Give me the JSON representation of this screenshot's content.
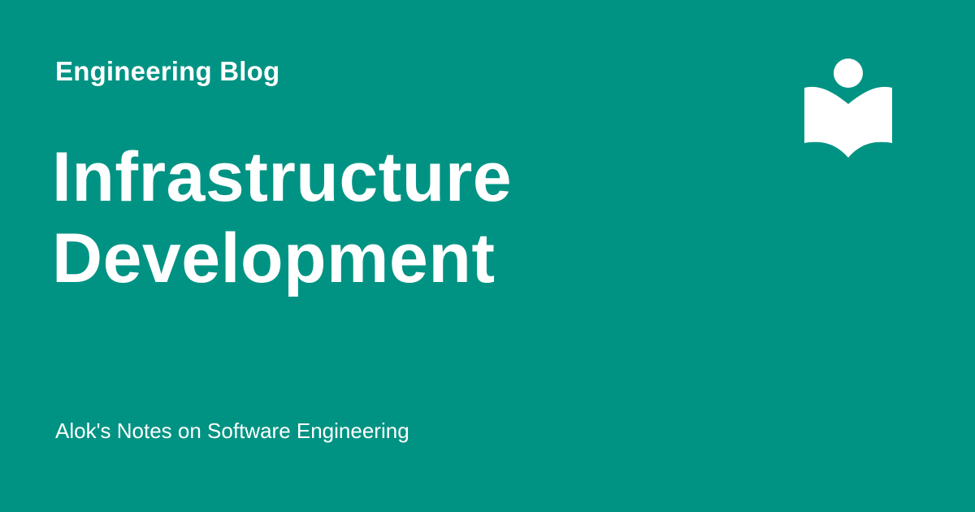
{
  "theme": {
    "background_color": "#009383",
    "text_color": "#ffffff"
  },
  "header": {
    "blog_name": "Engineering Blog"
  },
  "post": {
    "title_line_1": "Infrastructure",
    "title_line_2": "Development"
  },
  "footer": {
    "tagline": "Alok's Notes on Software Engineering"
  },
  "logo": {
    "icon": "reader-book-icon"
  }
}
